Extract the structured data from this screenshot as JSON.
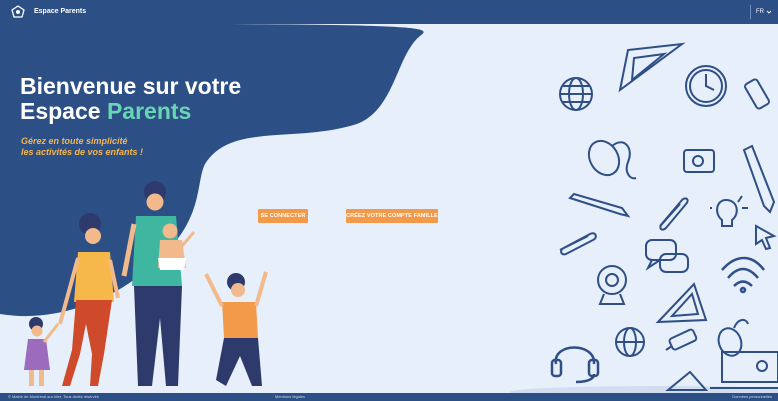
{
  "header": {
    "app_title": "Espace Parents",
    "language": "FR",
    "language_chevron_icon": "chevron-down-icon",
    "logo_icon": "logo-icon"
  },
  "hero": {
    "title_line1": "Bienvenue sur votre",
    "title_line2_prefix": "Espace ",
    "title_line2_accent": "Parents",
    "subtitle_line1": "Gérez en toute simplicité",
    "subtitle_line2": "les activités de vos enfants !",
    "login_button": "SE CONNECTER",
    "create_account_button": "CRÉEZ VOTRE COMPTE FAMILLE"
  },
  "footer": {
    "left_text": "© Mairie de Montreuil-sur-Mer, Tous droits réservés",
    "middle_text": "Mentions légales",
    "right_text": "Données personnelles"
  },
  "colors": {
    "navy": "#2c4f86",
    "hero_bg": "#e6effa",
    "accent_green": "#69d5b6",
    "subtitle_yellow": "#f6b64a",
    "button_orange": "#f29a4a",
    "icon_line": "#2f4f86"
  },
  "icons": [
    "globe-icon",
    "set-square-icon",
    "clock-icon",
    "usb-icon",
    "mouse-icon",
    "sharpener-icon",
    "pencil-icon",
    "paperclip-icon",
    "lightbulb-icon",
    "chat-bubble-icon",
    "wifi-icon",
    "webcam-icon",
    "cursor-icon",
    "headphones-icon",
    "laptop-icon"
  ]
}
